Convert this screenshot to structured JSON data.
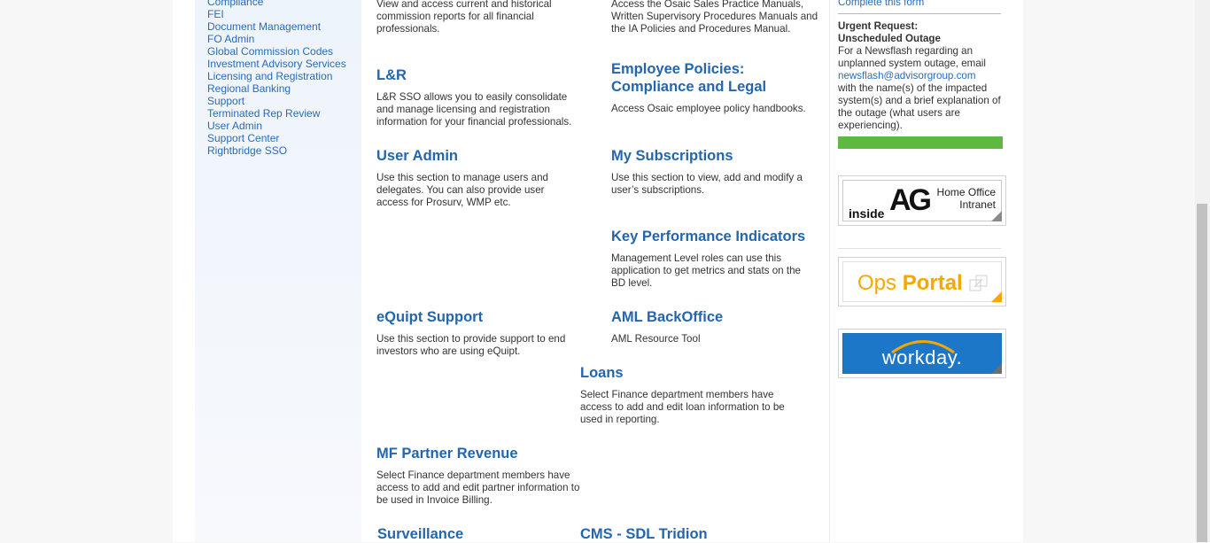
{
  "sidebar": {
    "items": [
      {
        "label": "Compliance"
      },
      {
        "label": "FEI"
      },
      {
        "label": "Document Management"
      },
      {
        "label": "FO Admin"
      },
      {
        "label": "Global Commission Codes"
      },
      {
        "label": "Investment Advisory Services"
      },
      {
        "label": "Licensing and Registration"
      },
      {
        "label": "Regional Banking"
      },
      {
        "label": "Support"
      },
      {
        "label": "Terminated Rep Review"
      },
      {
        "label": "User Admin"
      },
      {
        "label": "Support Center"
      },
      {
        "label": "Rightbridge SSO"
      }
    ]
  },
  "cards": {
    "commission_desc": "View and access current and historical commission reports for all financial professionals.",
    "sales_manuals_desc": "Access the Osaic Sales Practice Manuals, Written Supervisory Procedures Manuals and the IA Policies and Procedures Manual.",
    "lr": {
      "title": "L&R",
      "desc": "L&R SSO allows you to easily consolidate and manage licensing and registration information for your financial professionals."
    },
    "employee_policies": {
      "title": "Employee Policies: Compliance and Legal",
      "desc": "Access Osaic employee policy handbooks."
    },
    "user_admin": {
      "title": "User Admin",
      "desc": "Use this section to manage users and delegates. You can also provide user access for Prosurv, WMP etc."
    },
    "my_subscriptions": {
      "title": "My Subscriptions",
      "desc": "Use this section to view, add and modify a user’s subscriptions."
    },
    "kpi": {
      "title": "Key Performance Indicators",
      "desc": "Management Level roles can use this application to get metrics and stats on the BD level."
    },
    "equipt": {
      "title": "eQuipt Support",
      "desc": "Use this section to provide support to end investors who are using eQuipt."
    },
    "aml": {
      "title": "AML BackOffice",
      "desc": "AML Resource Tool"
    },
    "loans": {
      "title": "Loans",
      "desc": "Select Finance department members have access to add and edit loan information to be used in reporting."
    },
    "mf_partner": {
      "title": "MF Partner Revenue",
      "desc": "Select Finance department members have access to add and edit partner information to be used in Invoice Billing."
    },
    "surveillance": {
      "title": "Surveillance"
    },
    "cms": {
      "title": "CMS - SDL Tridion"
    }
  },
  "right": {
    "complete_form_link": "Complete this form",
    "urgent_title": "Urgent Request:",
    "urgent_subtitle": "Unscheduled Outage",
    "urgent_text_1": "For a Newsflash regarding an unplanned system outage, email",
    "urgent_email": "newsflash@advisorgroup.com",
    "urgent_text_2": "with the name(s) of the impacted system(s) and a brief explanation of the outage (what users are experiencing).",
    "tiles": {
      "intranet": {
        "inside": "inside",
        "logo": "AG",
        "line1": "Home Office",
        "line2": "Intranet"
      },
      "ops": {
        "word1": "Ops",
        "word2": "Portal"
      },
      "workday": {
        "label": "workday."
      }
    }
  },
  "colors": {
    "link": "#2a6bb7",
    "title": "#2466ad",
    "green_bar": "#5fb842",
    "workday_blue": "#1d77c8",
    "ops_orange": "#f7a700"
  }
}
